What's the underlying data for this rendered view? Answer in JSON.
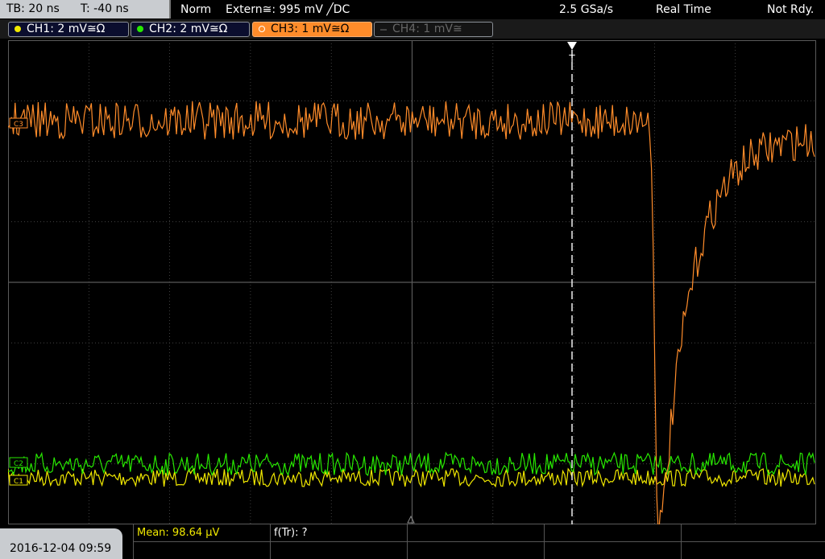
{
  "topbar": {
    "timebase": "TB: 20 ns",
    "trigger_time": "T: -40 ns",
    "trigger_mode": "Norm",
    "trigger_source": "Extern≅: 995 mV ╱DC",
    "sample_rate": "2.5 GSa/s",
    "acq_mode": "Real Time",
    "status": "Not Rdy."
  },
  "channels": [
    {
      "label": "CH1: 2 mV≅Ω",
      "color": "#f0e800",
      "active": true
    },
    {
      "label": "CH2: 2 mV≅Ω",
      "color": "#27e800",
      "active": true
    },
    {
      "label": "CH3: 1 mV≅Ω",
      "color": "#ff8c2a",
      "active": true,
      "selected": true
    },
    {
      "label": "CH4: 1 mV≅",
      "color": "#555555",
      "active": false
    }
  ],
  "markers": {
    "trigger_marker": "T",
    "ch3_ref": "C3",
    "ch2_ref": "C2",
    "ch1_ref": "C1"
  },
  "status_bar": {
    "datetime": "2016-12-04 09:59",
    "measurement_1": "Mean: 98.64 µV",
    "measurement_2": "f(Tr): ?"
  },
  "colors": {
    "ch1": "#f0e800",
    "ch2": "#27e800",
    "ch3": "#ff8c2a",
    "grid": "#5a5a5a",
    "background": "#000000"
  }
}
